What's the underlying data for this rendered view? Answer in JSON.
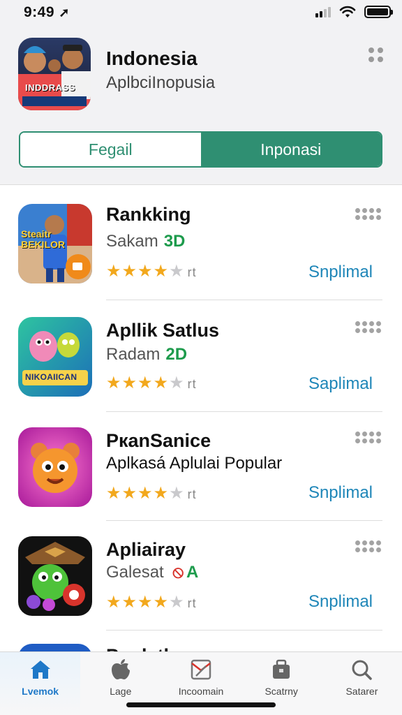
{
  "status": {
    "time": "9:49"
  },
  "header": {
    "title": "Indonesia",
    "subtitle": "AplbciInopusia",
    "thumb_text": "INDDRASS",
    "segments": [
      {
        "label": "Fegail",
        "selected": false
      },
      {
        "label": "Inponasi",
        "selected": true
      }
    ]
  },
  "apps": [
    {
      "name": "Rankking",
      "sub": "Sakam",
      "badge": "3D",
      "icon_text": "Steaitr BEKILOR",
      "rating": 4,
      "rating_count": "rt",
      "action": "Snplimal"
    },
    {
      "name": "Apllik Satlus",
      "sub": "Radam",
      "badge": "2D",
      "icon_text": "NIKOAIICAN",
      "rating": 4,
      "rating_count": "rt",
      "action": "Saplimal"
    },
    {
      "name": "PкanSanice",
      "sub": "Aplkasá Aplulai Popular",
      "badge": "",
      "icon_text": "",
      "rating": 4,
      "rating_count": "rt",
      "action": "Snplimal"
    },
    {
      "name": "Apliairay",
      "sub": "Galesat",
      "badge": "A",
      "icon_text": "",
      "rating": 4,
      "rating_count": "rt",
      "action": "Snplimal"
    }
  ],
  "partial_app": {
    "name": "Puglatlau"
  },
  "tabs": [
    {
      "label": "Lvemok",
      "icon": "home-icon",
      "active": true
    },
    {
      "label": "Lage",
      "icon": "apple-icon",
      "active": false
    },
    {
      "label": "Incoomain",
      "icon": "mail-icon",
      "active": false
    },
    {
      "label": "Scatrny",
      "icon": "bag-icon",
      "active": false
    },
    {
      "label": "Satarer",
      "icon": "search-icon",
      "active": false
    }
  ],
  "colors": {
    "accent": "#2f8f72",
    "link": "#1e86b8",
    "star": "#f2a81d",
    "tab_active": "#1e78c8"
  }
}
